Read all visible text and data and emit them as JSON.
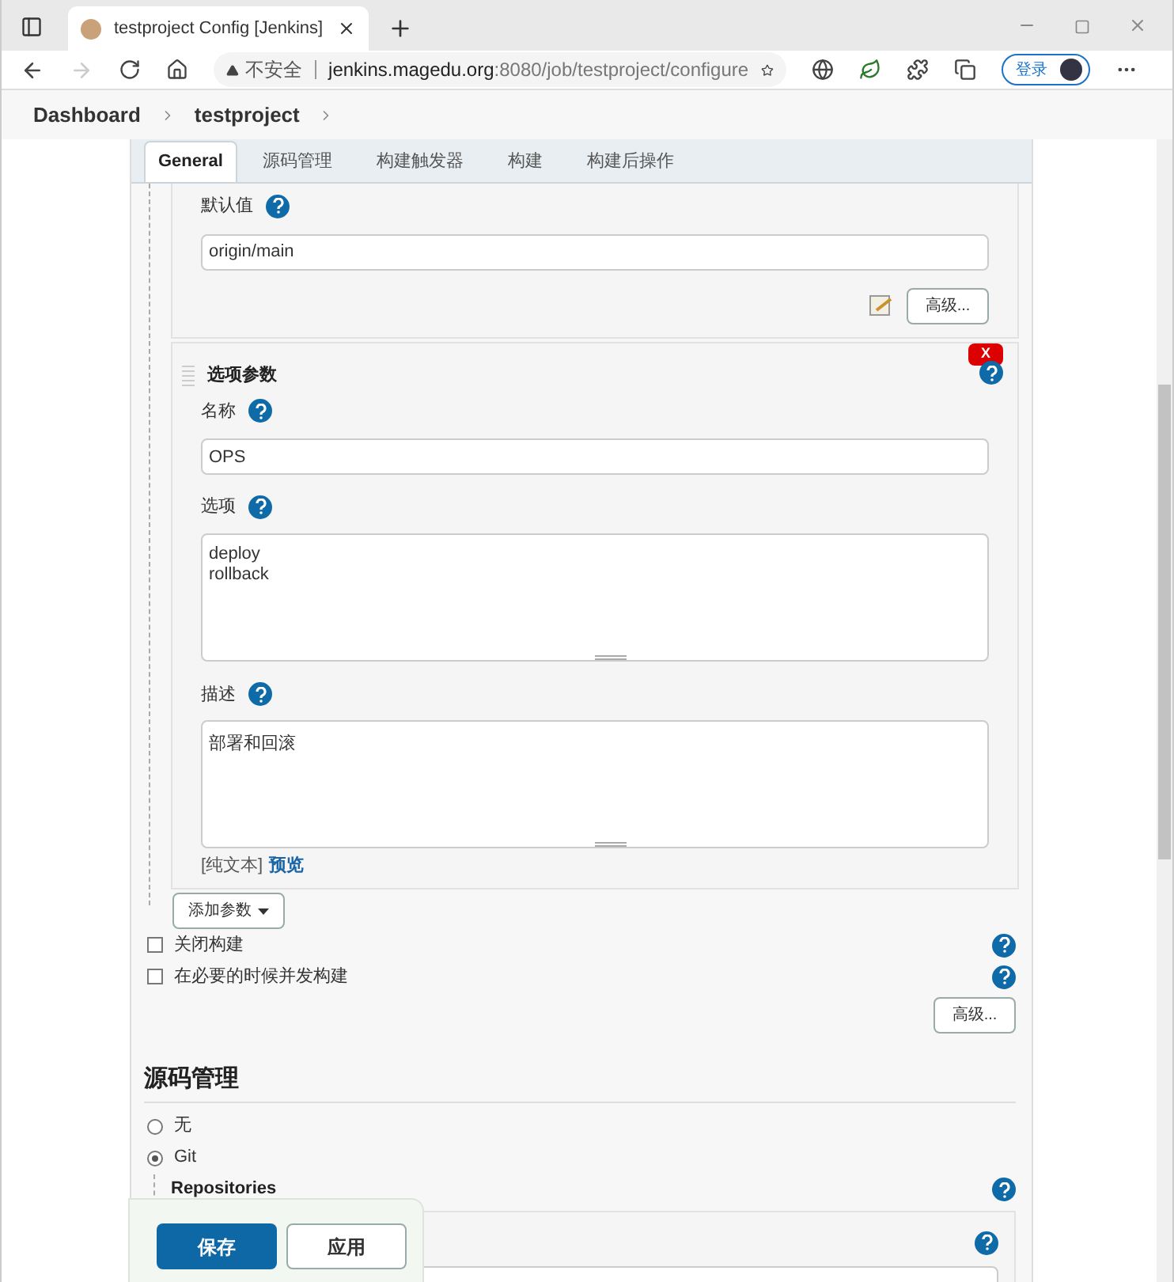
{
  "browser": {
    "tab_title": "testproject Config [Jenkins]",
    "security": "不安全",
    "url_host": "jenkins.magedu.org",
    "url_rest": ":8080/job/testproject/configure",
    "login": "登录"
  },
  "breadcrumbs": [
    "Dashboard",
    "testproject"
  ],
  "tabs": [
    {
      "label": "General",
      "selected": true
    },
    {
      "label": "源码管理",
      "selected": false
    },
    {
      "label": "构建触发器",
      "selected": false
    },
    {
      "label": "构建",
      "selected": false
    },
    {
      "label": "构建后操作",
      "selected": false
    }
  ],
  "default_value": {
    "label": "默认值",
    "value": "origin/main",
    "advanced": "高级..."
  },
  "choice_param": {
    "title": "选项参数",
    "delete": "X",
    "name_label": "名称",
    "name_value": "OPS",
    "choices_label": "选项",
    "choices_lines": [
      "deploy",
      "rollback"
    ],
    "desc_label": "描述",
    "desc_value": "部署和回滚",
    "plain_text": "[纯文本]",
    "preview": "预览"
  },
  "add_param": "添加参数",
  "options": [
    {
      "label": "关闭构建",
      "checked": false
    },
    {
      "label": "在必要的时候并发构建",
      "checked": false
    }
  ],
  "advanced": "高级...",
  "scm": {
    "heading": "源码管理",
    "radios": [
      {
        "label": "无",
        "selected": false
      },
      {
        "label": "Git",
        "selected": true
      }
    ],
    "repositories": "Repositories"
  },
  "save_bar": {
    "save": "保存",
    "apply": "应用"
  }
}
